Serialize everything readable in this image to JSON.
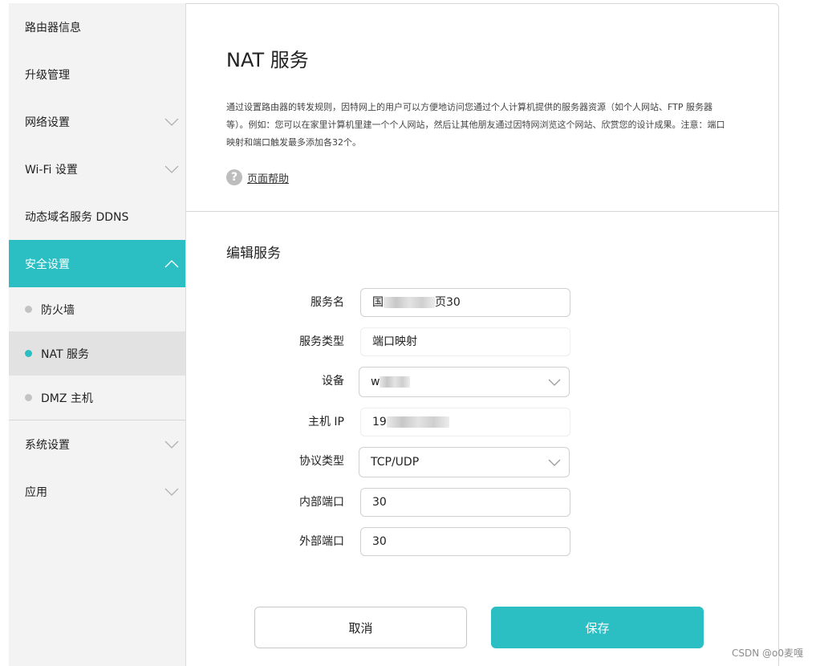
{
  "sidebar": {
    "items": [
      {
        "label": "路由器信息"
      },
      {
        "label": "升级管理"
      },
      {
        "label": "网络设置"
      },
      {
        "label": "Wi-Fi 设置"
      },
      {
        "label": "动态域名服务 DDNS"
      },
      {
        "label": "安全设置"
      },
      {
        "label": "系统设置"
      },
      {
        "label": "应用"
      }
    ],
    "sub_items": [
      {
        "label": "防火墙"
      },
      {
        "label": "NAT 服务"
      },
      {
        "label": "DMZ 主机"
      }
    ]
  },
  "main": {
    "title": "NAT 服务",
    "description": "通过设置路由器的转发规则，因特网上的用户可以方便地访问您通过个人计算机提供的服务器资源（如个人网站、FTP 服务器等）。例如：您可以在家里计算机里建一个个人网站，然后让其他朋友通过因特网浏览这个网站、欣赏您的设计成果。注意：端口映射和端口触发最多添加各32个。",
    "help_label": "页面帮助",
    "section_title": "编辑服务",
    "form": {
      "service_name": {
        "label": "服务名",
        "value_prefix": "国",
        "value_suffix": "页30"
      },
      "service_type": {
        "label": "服务类型",
        "value": "端口映射"
      },
      "device": {
        "label": "设备",
        "value_prefix": "w"
      },
      "host_ip": {
        "label": "主机 IP",
        "value_prefix": "19"
      },
      "protocol": {
        "label": "协议类型",
        "value": "TCP/UDP"
      },
      "internal_port": {
        "label": "内部端口",
        "value": "30"
      },
      "external_port": {
        "label": "外部端口",
        "value": "30"
      }
    },
    "buttons": {
      "cancel": "取消",
      "save": "保存"
    }
  },
  "watermark": "CSDN @o0麦嘎",
  "colors": {
    "accent": "#2bbfc4"
  }
}
